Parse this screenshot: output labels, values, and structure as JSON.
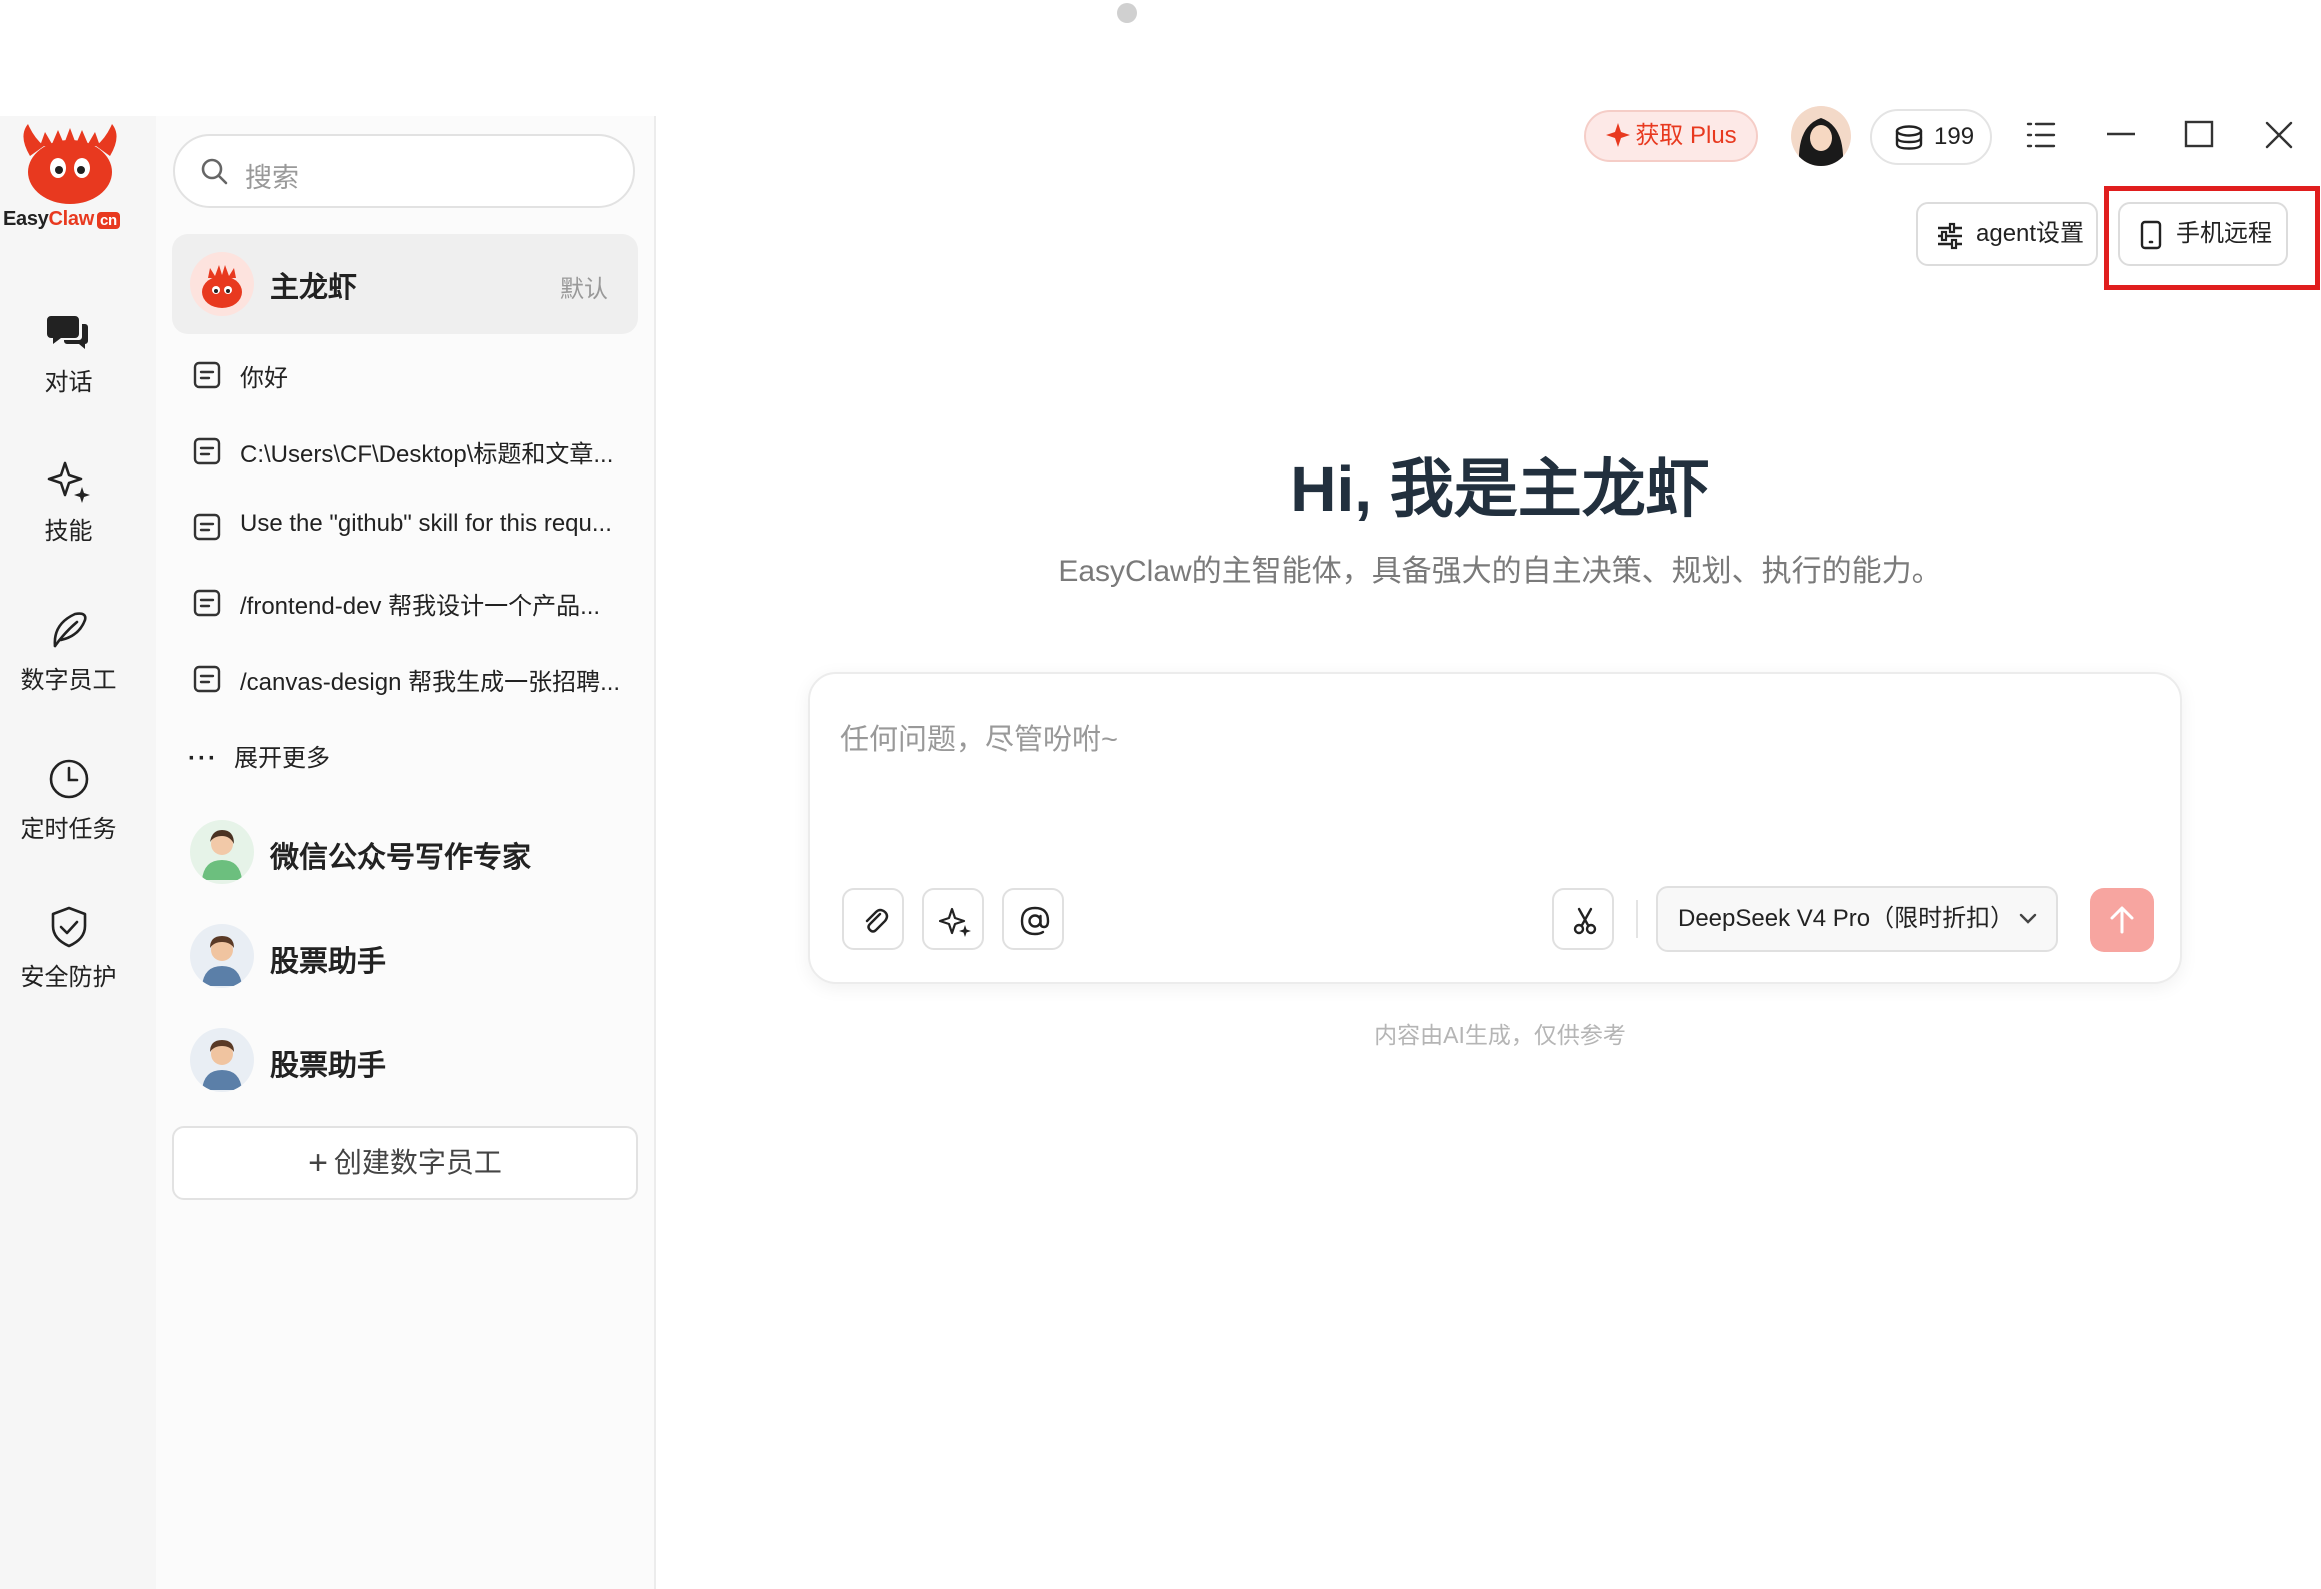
{
  "brand": {
    "name_easy": "Easy",
    "name_claw": "Claw",
    "name_cn": "cn"
  },
  "nav": [
    {
      "label": "对话",
      "icon": "chat-icon"
    },
    {
      "label": "技能",
      "icon": "sparkle-icon"
    },
    {
      "label": "数字员工",
      "icon": "leaf-icon"
    },
    {
      "label": "定时任务",
      "icon": "clock-icon"
    },
    {
      "label": "安全防护",
      "icon": "shield-icon"
    }
  ],
  "search": {
    "placeholder": "搜索"
  },
  "agent": {
    "name": "主龙虾",
    "badge": "默认"
  },
  "history": [
    "你好",
    "C:\\Users\\CF\\Desktop\\标题和文章...",
    "Use the \"github\" skill for this requ...",
    "/frontend-dev 帮我设计一个产品...",
    "/canvas-design 帮我生成一张招聘..."
  ],
  "expand_more": "展开更多",
  "employees": [
    {
      "name": "微信公众号写作专家"
    },
    {
      "name": "股票助手"
    },
    {
      "name": "股票助手"
    }
  ],
  "create_employee": "创建数字员工",
  "topbar": {
    "plus_label": "获取 Plus",
    "credits": "199",
    "agent_settings": "agent设置",
    "phone_remote": "手机远程"
  },
  "main": {
    "greeting": "Hi, 我是主龙虾",
    "subtitle": "EasyClaw的主智能体，具备强大的自主决策、规划、执行的能力。",
    "input_placeholder": "任何问题，尽管吩咐~",
    "model": "DeepSeek V4 Pro（限时折扣）",
    "disclaimer": "内容由AI生成，仅供参考"
  },
  "colors": {
    "accent": "#e8391f",
    "send_button": "#f7a5a0",
    "highlight_box": "#e01e1e"
  }
}
